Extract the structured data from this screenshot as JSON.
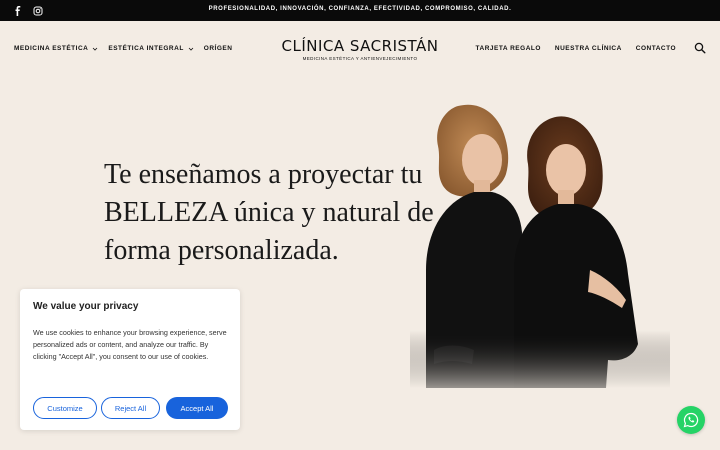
{
  "topbar": {
    "tagline": "PROFESIONALIDAD, INNOVACIÓN, CONFIANZA, EFECTIVIDAD, COMPROMISO, CALIDAD."
  },
  "nav": {
    "left": [
      {
        "label": "MEDICINA ESTÉTICA",
        "has_dropdown": true
      },
      {
        "label": "ESTÉTICA INTEGRAL",
        "has_dropdown": true
      },
      {
        "label": "ORÍGEN",
        "has_dropdown": false
      }
    ],
    "right": [
      {
        "label": "TARJETA REGALO"
      },
      {
        "label": "NUESTRA CLÍNICA"
      },
      {
        "label": "CONTACTO"
      }
    ]
  },
  "logo": {
    "name": "CLÍNICA SACRISTÁN",
    "subtitle": "MEDICINA ESTÉTICA Y ANTIENVEJECIMIENTO"
  },
  "hero": {
    "title": "Te enseñamos a proyectar tu BELLEZA única y natural de forma personalizada."
  },
  "cookie": {
    "title": "We value your privacy",
    "text": "We use cookies to enhance your browsing experience, serve personalized ads or content, and analyze our traffic. By clicking \"Accept All\", you consent to our use of cookies.",
    "customize": "Customize",
    "reject": "Reject All",
    "accept": "Accept All"
  },
  "colors": {
    "background": "#f3ece4",
    "topbar": "#0a0a0a",
    "accent": "#1863dc",
    "whatsapp": "#25d366"
  },
  "icons": [
    "facebook-icon",
    "instagram-icon",
    "chevron-down-icon",
    "search-icon",
    "whatsapp-icon"
  ]
}
